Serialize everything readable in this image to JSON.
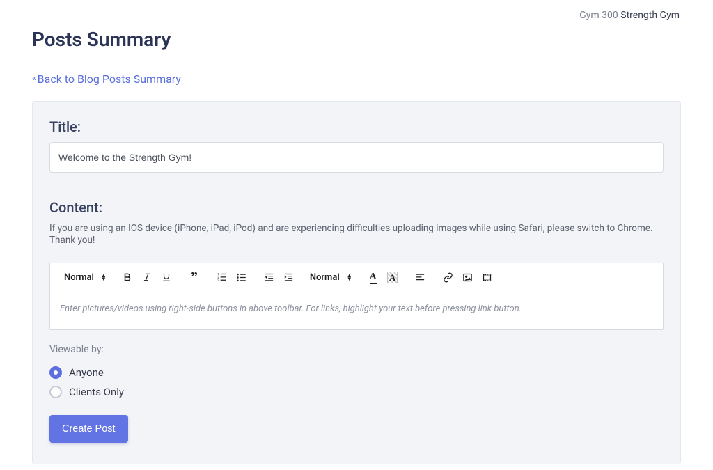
{
  "header": {
    "breadcrumb_prefix": "Gym 300 ",
    "breadcrumb_strong": "Strength Gym"
  },
  "page_title": "Posts Summary",
  "back_link": "Back to Blog Posts Summary",
  "form": {
    "title_label": "Title:",
    "title_value": "Welcome to the Strength Gym!",
    "content_label": "Content:",
    "help_text": "If you are using an IOS device (iPhone, iPad, iPod) and are experiencing difficulties uploading images while using Safari, please switch to Chrome. Thank you!",
    "editor": {
      "style_select": "Normal",
      "size_select": "Normal",
      "placeholder": "Enter pictures/videos using right-side buttons in above toolbar. For links, highlight your text before pressing link button."
    },
    "viewable_label": "Viewable by:",
    "radios": {
      "anyone": "Anyone",
      "clients_only": "Clients Only"
    },
    "submit_label": "Create Post"
  }
}
